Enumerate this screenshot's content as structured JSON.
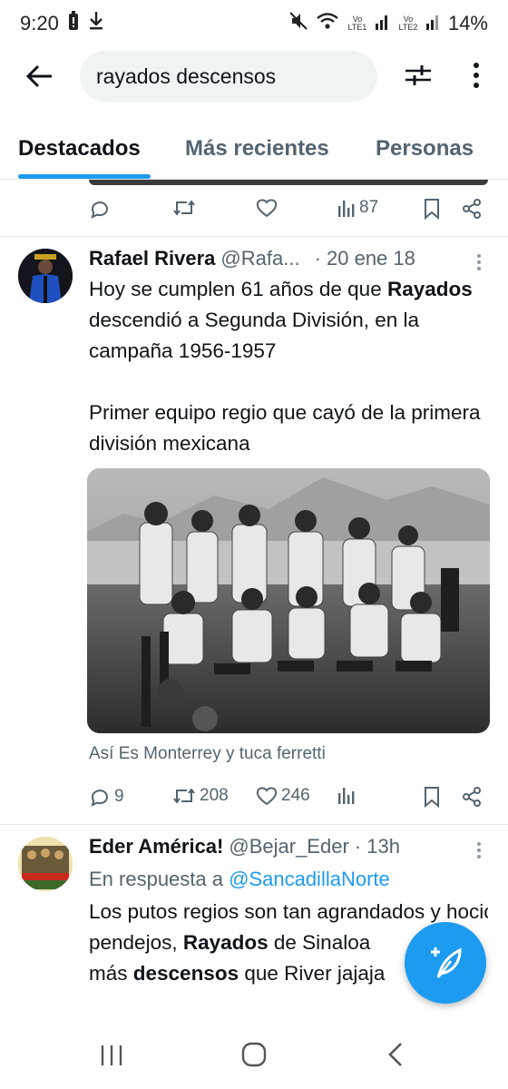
{
  "status_bar": {
    "time": "9:20",
    "sim1": "Vo LTE1",
    "sim2": "Vo LTE2",
    "battery": "14%"
  },
  "search": {
    "query": "rayados descensos"
  },
  "tabs": [
    {
      "label": "Destacados",
      "active": true
    },
    {
      "label": "Más recientes",
      "active": false
    },
    {
      "label": "Personas",
      "active": false
    }
  ],
  "prev_tweet_actions": {
    "views": "87"
  },
  "tweets": [
    {
      "name": "Rafael Rivera",
      "handle": "@Rafa...",
      "time": "· 20 ene 18",
      "text_parts": [
        "Hoy se cumplen 61 años de que ",
        "Rayados",
        " descendió a Segunda División, en la campaña 1956-1957",
        "Primer equipo regio que cayó de la primera división mexicana"
      ],
      "caption": "Así Es Monterrey y tuca ferretti",
      "replies": "9",
      "retweets": "208",
      "likes": "246"
    },
    {
      "name": "Eder América!",
      "handle": "@Bejar_Eder",
      "time": "· 13h",
      "reply_prefix": "En respuesta a",
      "reply_to": "@SancadillaNorte",
      "avatar_text": "BICAMPEONES",
      "text_parts": [
        "Los putos regios son tan agrandados y hocicones para a la vez ser ta",
        "pendejos, ",
        "Rayados",
        " de Sinaloa",
        "más ",
        "descensos",
        " que River jajaja"
      ]
    }
  ],
  "colors": {
    "accent": "#1d9bf0",
    "text": "#0f1419",
    "secondary": "#536471"
  }
}
